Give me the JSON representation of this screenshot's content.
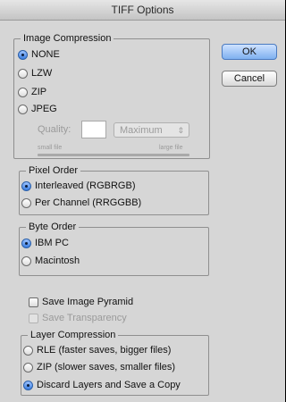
{
  "window": {
    "title": "TIFF Options"
  },
  "buttons": {
    "ok": "OK",
    "cancel": "Cancel"
  },
  "image_compression": {
    "legend": "Image Compression",
    "options": [
      "NONE",
      "LZW",
      "ZIP",
      "JPEG"
    ],
    "selected": "NONE",
    "quality_label": "Quality:",
    "quality_value": "",
    "quality_preset": "Maximum",
    "small_file": "small file",
    "large_file": "large file"
  },
  "pixel_order": {
    "legend": "Pixel Order",
    "options": [
      "Interleaved (RGBRGB)",
      "Per Channel (RRGGBB)"
    ],
    "selected": "Interleaved (RGBRGB)"
  },
  "byte_order": {
    "legend": "Byte Order",
    "options": [
      "IBM PC",
      "Macintosh"
    ],
    "selected": "IBM PC"
  },
  "checkboxes": {
    "save_image_pyramid": "Save Image Pyramid",
    "save_transparency": "Save Transparency"
  },
  "layer_compression": {
    "legend": "Layer Compression",
    "options": [
      "RLE (faster saves, bigger files)",
      "ZIP (slower saves, smaller files)",
      "Discard Layers and Save a Copy"
    ],
    "selected": "Discard Layers and Save a Copy"
  },
  "colors": {
    "dialog_bg": "#d6d6d6",
    "default_button": "#7fb0f0",
    "radio_selected": "#3b7ee0"
  }
}
